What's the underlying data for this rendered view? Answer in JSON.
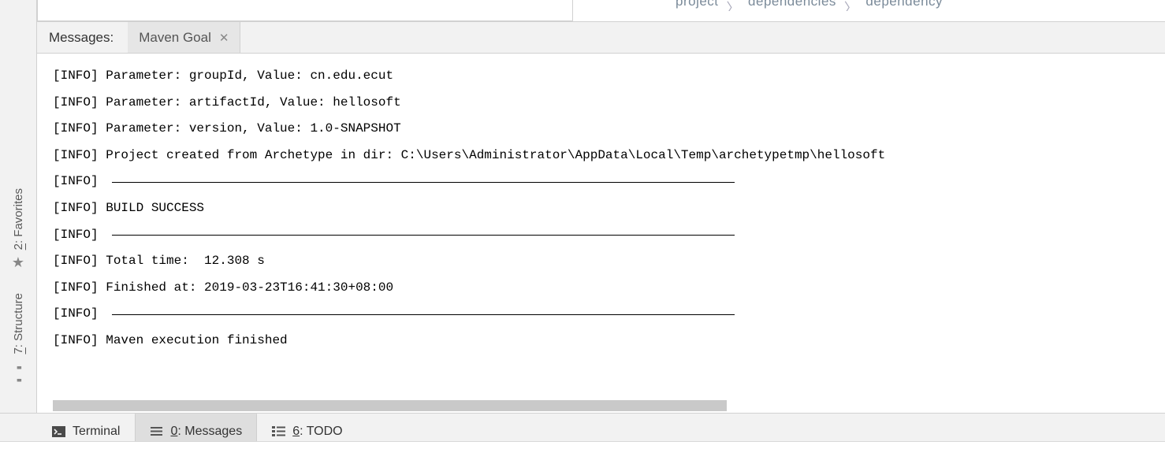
{
  "breadcrumb": {
    "a": "project",
    "b": "dependencies",
    "c": "dependency"
  },
  "leftToolbar": {
    "favorites_label": ": Favorites",
    "favorites_key": "2",
    "structure_label": ": Structure",
    "structure_key": "7"
  },
  "panel": {
    "title": "Messages:",
    "tab_label": "Maven Goal"
  },
  "console": {
    "lines": [
      "[INFO] Parameter: groupId, Value: cn.edu.ecut",
      "[INFO] Parameter: artifactId, Value: hellosoft",
      "[INFO] Parameter: version, Value: 1.0-SNAPSHOT",
      "[INFO] Project created from Archetype in dir: C:\\Users\\Administrator\\AppData\\Local\\Temp\\archetypetmp\\hellosoft",
      "[INFO] ",
      "[INFO] BUILD SUCCESS",
      "[INFO] ",
      "[INFO] Total time:  12.308 s",
      "[INFO] Finished at: 2019-03-23T16:41:30+08:00",
      "[INFO] ",
      "[INFO] Maven execution finished"
    ],
    "rule_indices": [
      4,
      6,
      9
    ]
  },
  "bottomTabs": {
    "terminal": "Terminal",
    "messages_key": "0",
    "messages_label": ": Messages",
    "todo_key": "6",
    "todo_label": ": TODO"
  }
}
